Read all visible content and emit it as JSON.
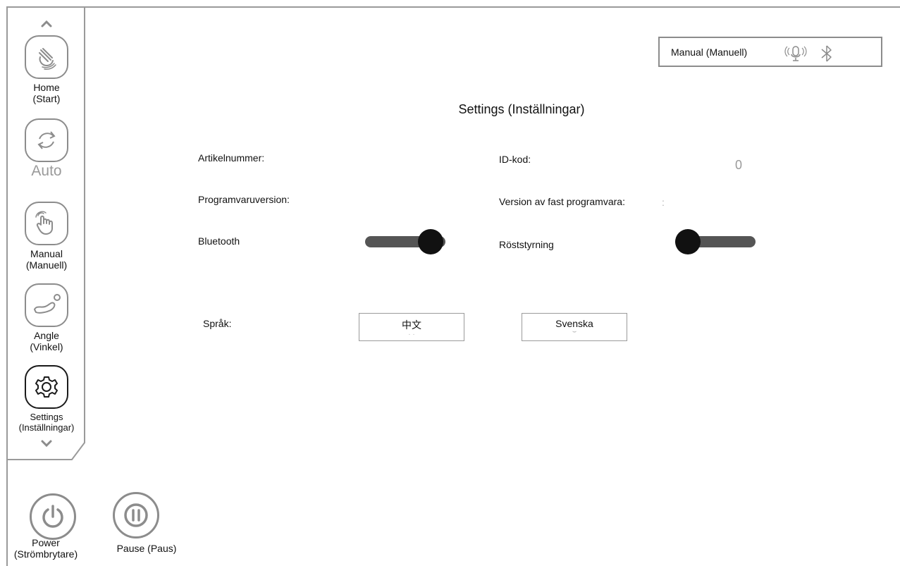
{
  "sidebar": {
    "items": [
      {
        "name": "home",
        "label": "Home\n(Start)",
        "icon": "hand-swipe-icon"
      },
      {
        "name": "auto",
        "label": "Auto",
        "icon": "sync-icon"
      },
      {
        "name": "manual",
        "label": "Manual\n(Manuell)",
        "icon": "hand-pointer-icon"
      },
      {
        "name": "angle",
        "label": "Angle\n(Vinkel)",
        "icon": "recline-angle-icon"
      },
      {
        "name": "settings",
        "label": "Settings\n(Inställningar)",
        "icon": "gear-icon",
        "active": true
      }
    ]
  },
  "status": {
    "mode": "Manual (Manuell)",
    "icons": [
      "voice-icon",
      "bluetooth-icon"
    ]
  },
  "page": {
    "title": "Settings (Inställningar)"
  },
  "fields": {
    "article_number_label": "Artikelnummer:",
    "id_code_label": "ID-kod:",
    "id_code_value": "0",
    "software_version_label": "Programvaruversion:",
    "firmware_version_label": "Version av fast programvara:",
    "firmware_version_value": ":",
    "bluetooth_label": "Bluetooth",
    "bluetooth_on": true,
    "voice_control_label": "Röststyrning",
    "voice_control_on": false,
    "language_label": "Språk:",
    "languages": [
      "中文",
      "Svenska"
    ]
  },
  "bottom": {
    "power_label": "Power\n(Strömbrytare)",
    "pause_label": "Pause (Paus)"
  },
  "colors": {
    "border": "#8c8c8c",
    "toggle_track": "#555555",
    "toggle_knob": "#111111"
  }
}
